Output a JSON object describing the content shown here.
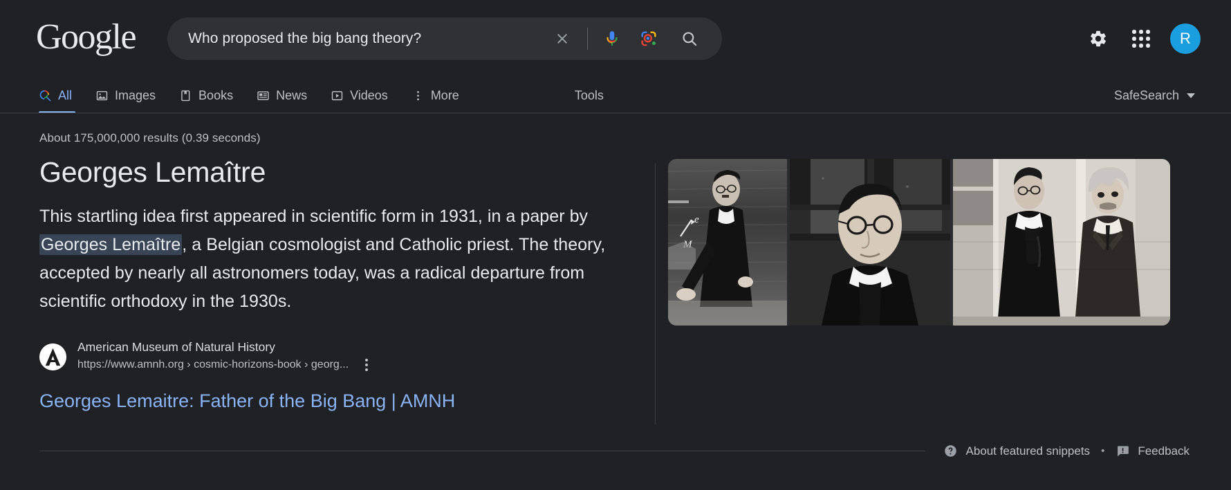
{
  "page": {
    "background_color": "#202124",
    "text_color": "#e8eaed",
    "link_color": "#8ab4f8",
    "muted_color": "#bdc1c6",
    "accent_color": "#8ab4f8",
    "avatar_color": "#1a9ee0",
    "highlight_color": "#394457"
  },
  "header": {
    "logo_text": "Google",
    "search": {
      "value": "Who proposed the big bang theory?",
      "placeholder": "Search",
      "clear_icon": "close-icon",
      "voice_icon": "microphone-icon",
      "lens_icon": "google-lens-icon",
      "search_icon": "search-icon"
    },
    "right_icons": [
      {
        "name": "settings-gear-icon",
        "label": "Settings"
      },
      {
        "name": "google-apps-grid-icon",
        "label": "Google apps"
      }
    ],
    "avatar": {
      "initial": "R",
      "label": "Google Account"
    }
  },
  "nav": {
    "tabs": [
      {
        "label": "All",
        "icon": "colored-search-icon",
        "active": true
      },
      {
        "label": "Images",
        "icon": "image-icon",
        "active": false
      },
      {
        "label": "Books",
        "icon": "book-icon",
        "active": false
      },
      {
        "label": "News",
        "icon": "news-icon",
        "active": false
      },
      {
        "label": "Videos",
        "icon": "video-play-icon",
        "active": false
      },
      {
        "label": "More",
        "icon": "more-vertical-icon",
        "active": false
      }
    ],
    "tools_label": "Tools",
    "safesearch_label": "SafeSearch",
    "safesearch_icon": "chevron-down-icon"
  },
  "results": {
    "stats": "About 175,000,000 results (0.39 seconds)",
    "featured_snippet": {
      "title": "Georges Lemaître",
      "body_part_1": "This startling idea first appeared in scientific form in 1931, in a paper by ",
      "body_highlight": "Georges Lemaître",
      "body_part_2": ", a Belgian cosmologist and Catholic priest. The theory, accepted by nearly all astronomers today, was a radical departure from scientific orthodoxy in the 1930s.",
      "source": {
        "favicon_letter": "A",
        "favicon_icon": "amnh-logo-icon",
        "site_name": "American Museum of Natural History",
        "url": "https://www.amnh.org › cosmic-horizons-book › georg...",
        "menu_icon": "kebab-menu-icon"
      },
      "link_title": "Georges Lemaitre: Father of the Big Bang | AMNH"
    },
    "images": [
      {
        "alt": "Georges Lemaître lecturing at a blackboard",
        "name": "thumbnail-lemaitre-blackboard"
      },
      {
        "alt": "Portrait of Georges Lemaître in clerical collar",
        "name": "thumbnail-lemaitre-portrait"
      },
      {
        "alt": "Georges Lemaître standing with Albert Einstein",
        "name": "thumbnail-lemaitre-einstein"
      }
    ]
  },
  "footer": {
    "about_icon": "help-circle-icon",
    "about_label": "About featured snippets",
    "separator": "•",
    "feedback_icon": "feedback-icon",
    "feedback_label": "Feedback"
  }
}
